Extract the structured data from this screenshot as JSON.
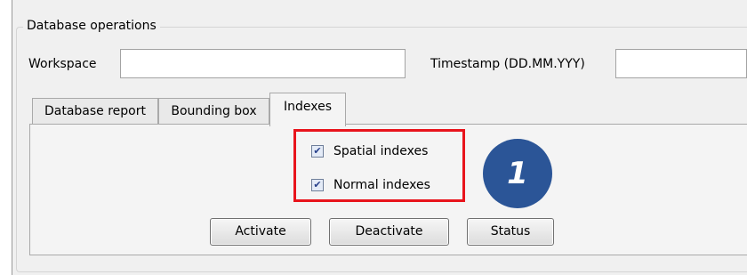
{
  "group": {
    "title": "Database operations"
  },
  "workspace": {
    "label": "Workspace",
    "value": ""
  },
  "timestamp": {
    "label": "Timestamp (DD.MM.YYY)",
    "value": ""
  },
  "tabs": [
    {
      "label": "Database report",
      "active": false
    },
    {
      "label": "Bounding box",
      "active": false
    },
    {
      "label": "Indexes",
      "active": true
    }
  ],
  "indexes": {
    "spatial": {
      "label": "Spatial indexes",
      "checked": true
    },
    "normal": {
      "label": "Normal indexes",
      "checked": true
    }
  },
  "buttons": {
    "activate": "Activate",
    "deactivate": "Deactivate",
    "status": "Status"
  },
  "annotation": {
    "badge_number": "1",
    "badge_color": "#2b5597",
    "highlight_color": "#e8141c"
  },
  "icons": {
    "checkmark": "checkmark-icon"
  }
}
